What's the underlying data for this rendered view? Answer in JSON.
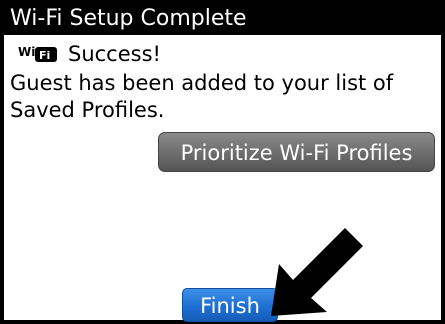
{
  "window": {
    "title": "Wi-Fi Setup Complete"
  },
  "status": {
    "icon": "wifi-badge-icon",
    "icon_text": "WiFi",
    "text": "Success!"
  },
  "message": {
    "line1": "Guest has been added to your list of",
    "line2": "Saved Profiles."
  },
  "buttons": {
    "prioritize_label": "Prioritize Wi-Fi Profiles",
    "finish_label": "Finish"
  },
  "overlay": {
    "arrow_icon": "pointer-arrow-icon",
    "arrow_color": "#000000"
  },
  "colors": {
    "title_bar": "#000000",
    "title_text": "#ffffff",
    "finish_button": "#1f6fd4",
    "prioritize_button": "#6f6f6f"
  }
}
